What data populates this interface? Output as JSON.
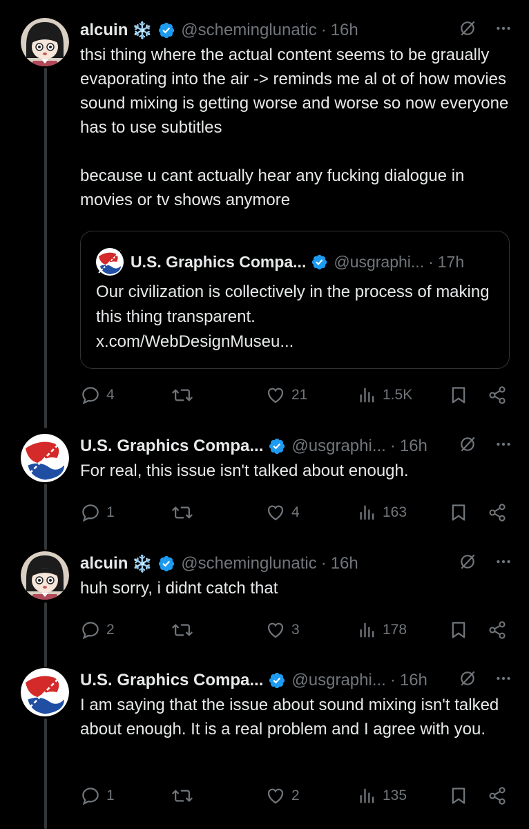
{
  "users": {
    "alcuin": {
      "name": "alcuin",
      "emoji": "❄️",
      "handle": "@scheminglunatic"
    },
    "usg": {
      "name": "U.S. Graphics Compa...",
      "handle": "@usgraphi..."
    }
  },
  "tweets": [
    {
      "time": "16h",
      "text": "thsi thing where the actual content seems to be graually evaporating into the air -> reminds me al ot of how movies sound mixing is getting worse and worse so now everyone has to use subtitles\n\nbecause u cant actually hear any fucking dialogue in movies or tv shows anymore",
      "quote": {
        "time": "17h",
        "text": "Our civilization is collectively in the process of making this thing transparent.",
        "link": "x.com/WebDesignMuseu..."
      },
      "replies": "4",
      "likes": "21",
      "views": "1.5K"
    },
    {
      "time": "16h",
      "text": "For real, this issue isn't talked about enough.",
      "replies": "1",
      "likes": "4",
      "views": "163"
    },
    {
      "time": "16h",
      "text": "huh sorry, i didnt catch that",
      "replies": "2",
      "likes": "3",
      "views": "178"
    },
    {
      "time": "16h",
      "text": "I am saying that the issue about sound mixing isn't talked about enough. It is a real problem and I agree with you.",
      "replies": "1",
      "likes": "2",
      "views": "135"
    }
  ],
  "colors": {
    "background": "#000000",
    "text": "#e7e9ea",
    "secondary": "#71767b",
    "verified": "#1d9bf0",
    "border": "#2f3336"
  }
}
